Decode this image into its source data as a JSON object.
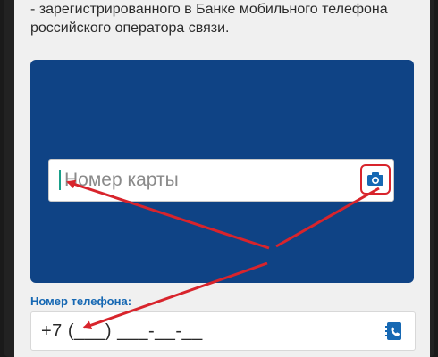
{
  "intro": {
    "line0": "...",
    "line1": "- зарегистрированного в Банке мобильного телефона",
    "line2": "российского оператора связи."
  },
  "card_input": {
    "placeholder": "Номер карты",
    "camera_icon": "camera-icon"
  },
  "phone": {
    "label": "Номер телефона:",
    "value": "+7 (___) ___-__-__",
    "contacts_icon": "contacts-book-icon"
  },
  "colors": {
    "panel": "#0f4385",
    "label": "#1668b3",
    "annotation": "#d8242c"
  }
}
